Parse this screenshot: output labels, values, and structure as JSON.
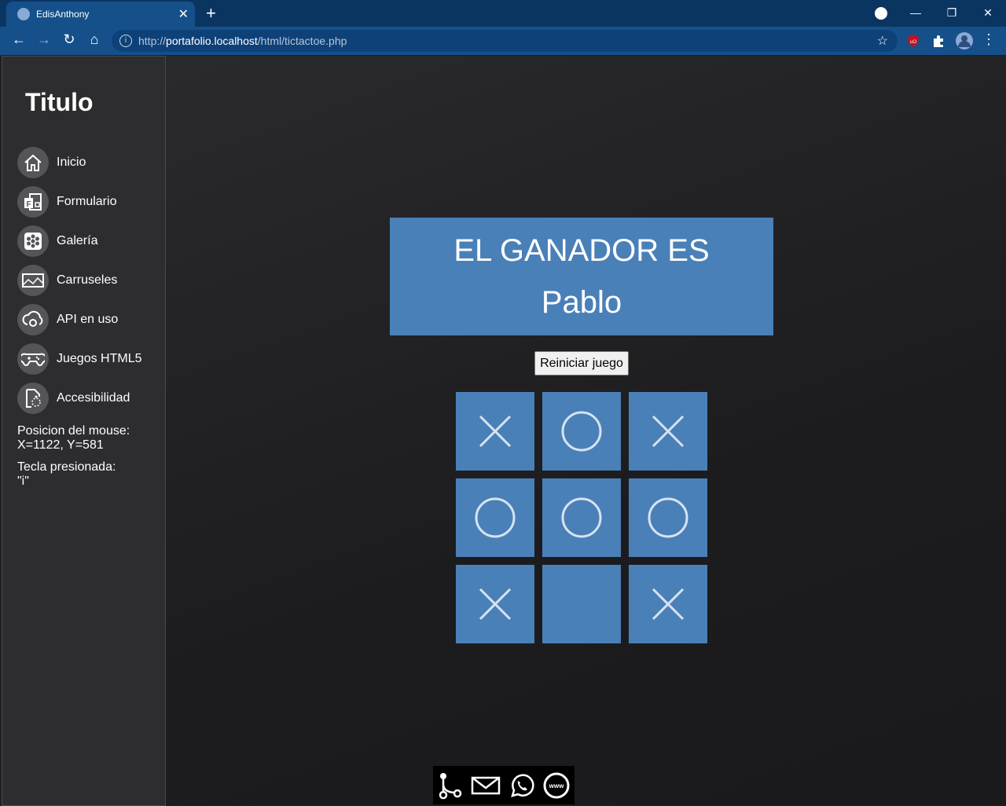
{
  "browser": {
    "tab_title": "EdisAnthony",
    "url_scheme": "http://",
    "url_host": "portafolio.localhost",
    "url_path": "/html/tictactoe.php",
    "accent": "#15508a"
  },
  "sidebar": {
    "title": "Titulo",
    "items": [
      {
        "label": "Inicio",
        "icon": "home-icon"
      },
      {
        "label": "Formulario",
        "icon": "form-icon"
      },
      {
        "label": "Galería",
        "icon": "gallery-icon"
      },
      {
        "label": "Carruseles",
        "icon": "carousel-icon"
      },
      {
        "label": "API en uso",
        "icon": "api-cloud-icon"
      },
      {
        "label": "Juegos HTML5",
        "icon": "gamepad-icon"
      },
      {
        "label": "Accesibilidad",
        "icon": "accessibility-icon"
      }
    ],
    "mouse_label": "Posicion del mouse:",
    "mouse_value": "X=1122, Y=581",
    "key_label": "Tecla presionada:",
    "key_value": "\"i\""
  },
  "game": {
    "winner_line1": "EL GANADOR ES",
    "winner_line2": "Pablo",
    "restart_label": "Reiniciar juego",
    "board": [
      "X",
      "O",
      "X",
      "O",
      "O",
      "O",
      "X",
      "",
      "X"
    ],
    "cell_color": "#4a80b8"
  },
  "footer": {
    "icons": [
      "git-icon",
      "mail-icon",
      "whatsapp-icon",
      "www-icon"
    ]
  }
}
